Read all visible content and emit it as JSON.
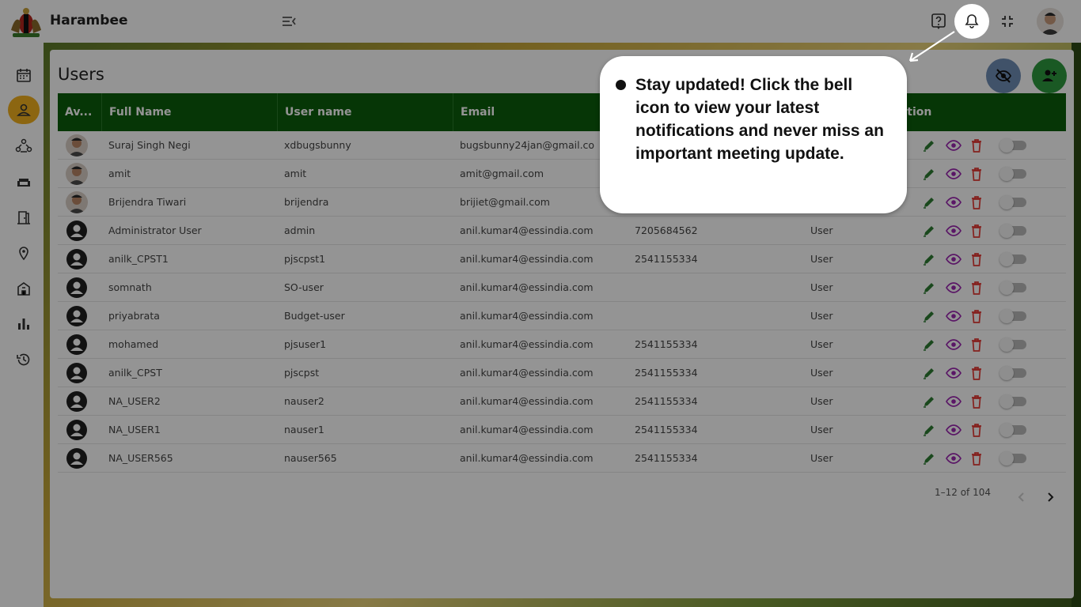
{
  "app": {
    "brand": "Harambee"
  },
  "page": {
    "title": "Users"
  },
  "table": {
    "columns": [
      "Av...",
      "Full Name",
      "User name",
      "Email",
      "",
      "",
      "ction"
    ],
    "rows": [
      {
        "full_name": "Suraj Singh Negi",
        "username": "xdbugsbunny",
        "email": "bugsbunny24jan@gmail.co",
        "phone": "",
        "role": "",
        "avatar": "photo"
      },
      {
        "full_name": "amit",
        "username": "amit",
        "email": "amit@gmail.com",
        "phone": "",
        "role": "",
        "avatar": "photo"
      },
      {
        "full_name": "Brijendra Tiwari",
        "username": "brijendra",
        "email": "brijiet@gmail.com",
        "phone": "",
        "role": "",
        "avatar": "photo"
      },
      {
        "full_name": "Administrator User",
        "username": "admin",
        "email": "anil.kumar4@essindia.com",
        "phone": "7205684562",
        "role": "User",
        "avatar": "default"
      },
      {
        "full_name": "anilk_CPST1",
        "username": "pjscpst1",
        "email": "anil.kumar4@essindia.com",
        "phone": "2541155334",
        "role": "User",
        "avatar": "default"
      },
      {
        "full_name": "somnath",
        "username": "SO-user",
        "email": "anil.kumar4@essindia.com",
        "phone": "",
        "role": "User",
        "avatar": "default"
      },
      {
        "full_name": "priyabrata",
        "username": "Budget-user",
        "email": "anil.kumar4@essindia.com",
        "phone": "",
        "role": "User",
        "avatar": "default"
      },
      {
        "full_name": "mohamed",
        "username": "pjsuser1",
        "email": "anil.kumar4@essindia.com",
        "phone": "2541155334",
        "role": "User",
        "avatar": "default"
      },
      {
        "full_name": "anilk_CPST",
        "username": "pjscpst",
        "email": "anil.kumar4@essindia.com",
        "phone": "2541155334",
        "role": "User",
        "avatar": "default"
      },
      {
        "full_name": "NA_USER2",
        "username": "nauser2",
        "email": "anil.kumar4@essindia.com",
        "phone": "2541155334",
        "role": "User",
        "avatar": "default"
      },
      {
        "full_name": "NA_USER1",
        "username": "nauser1",
        "email": "anil.kumar4@essindia.com",
        "phone": "2541155334",
        "role": "User",
        "avatar": "default"
      },
      {
        "full_name": "NA_USER565",
        "username": "nauser565",
        "email": "anil.kumar4@essindia.com",
        "phone": "2541155334",
        "role": "User",
        "avatar": "default"
      }
    ]
  },
  "pagination": {
    "range": "1–12 of 104"
  },
  "tooltip": {
    "message": "Stay updated! Click the bell icon to view your latest notifications and never miss an important meeting update."
  },
  "sidebar": {
    "items": [
      {
        "icon": "calendar-icon"
      },
      {
        "icon": "user-icon",
        "active": true
      },
      {
        "icon": "committee-icon"
      },
      {
        "icon": "sofa-icon"
      },
      {
        "icon": "door-icon"
      },
      {
        "icon": "location-icon"
      },
      {
        "icon": "building-icon"
      },
      {
        "icon": "bar-chart-icon"
      },
      {
        "icon": "history-icon"
      }
    ]
  },
  "colors": {
    "header_green": "#0b5e0b",
    "active_sidebar": "#f2b01e",
    "edit_icon": "#2e7d32",
    "view_icon": "#9c27b0",
    "delete_icon": "#e53935",
    "add_button": "#2e9a3e",
    "hide_button": "#6f8db5"
  }
}
